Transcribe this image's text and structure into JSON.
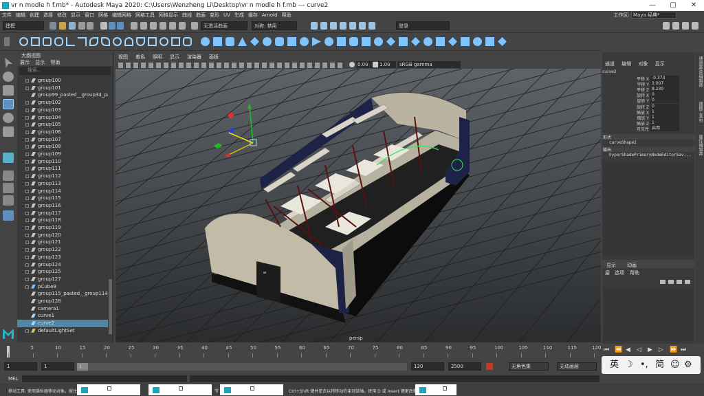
{
  "window": {
    "title": "vr n modle h f.mb* - Autodesk Maya 2020: C:\\Users\\Wenzheng Li\\Desktop\\vr n modle h f.mb   ---   curve2",
    "minimize": "—",
    "maximize": "▢",
    "close": "✕"
  },
  "menubar": {
    "items": [
      "文件",
      "编辑",
      "创建",
      "选择",
      "修改",
      "显示",
      "窗口",
      "网格",
      "编辑网格",
      "网格工具",
      "网格显示",
      "曲线",
      "曲面",
      "变形",
      "UV",
      "生成",
      "缓存",
      "Arnold",
      "帮助"
    ],
    "workspace_label": "工作区:",
    "workspace_value": "Maya 经典*"
  },
  "statusline": {
    "mode": "建模",
    "live_surface": "无激活曲面",
    "symmetry": "对称: 禁用",
    "login": "登录"
  },
  "outliner": {
    "title": "大纲视图",
    "menu": [
      "展示",
      "显示",
      "帮助"
    ],
    "search_placeholder": "搜索...",
    "items": [
      {
        "label": "group100",
        "type": "group",
        "expand": true
      },
      {
        "label": "group101",
        "type": "group",
        "expand": true
      },
      {
        "label": "group99_pasted__group34_pasts",
        "type": "group",
        "expand": false
      },
      {
        "label": "group102",
        "type": "group",
        "expand": true
      },
      {
        "label": "group103",
        "type": "group",
        "expand": true
      },
      {
        "label": "group104",
        "type": "group",
        "expand": true
      },
      {
        "label": "group105",
        "type": "group",
        "expand": true
      },
      {
        "label": "group106",
        "type": "group",
        "expand": true
      },
      {
        "label": "group107",
        "type": "group",
        "expand": true
      },
      {
        "label": "group108",
        "type": "group",
        "expand": true
      },
      {
        "label": "group109",
        "type": "group",
        "expand": true
      },
      {
        "label": "group110",
        "type": "group",
        "expand": true
      },
      {
        "label": "group111",
        "type": "group",
        "expand": true
      },
      {
        "label": "group112",
        "type": "group",
        "expand": true
      },
      {
        "label": "group113",
        "type": "group",
        "expand": true
      },
      {
        "label": "group114",
        "type": "group",
        "expand": true
      },
      {
        "label": "group115",
        "type": "group",
        "expand": true
      },
      {
        "label": "group116",
        "type": "group",
        "expand": true
      },
      {
        "label": "group117",
        "type": "group",
        "expand": true
      },
      {
        "label": "group118",
        "type": "group",
        "expand": true
      },
      {
        "label": "group119",
        "type": "group",
        "expand": true
      },
      {
        "label": "group120",
        "type": "group",
        "expand": true
      },
      {
        "label": "group121",
        "type": "group",
        "expand": true
      },
      {
        "label": "group122",
        "type": "group",
        "expand": true
      },
      {
        "label": "group123",
        "type": "group",
        "expand": true
      },
      {
        "label": "group124",
        "type": "group",
        "expand": true
      },
      {
        "label": "group125",
        "type": "group",
        "expand": true
      },
      {
        "label": "group127",
        "type": "group",
        "expand": true
      },
      {
        "label": "pCube9",
        "type": "mesh",
        "expand": true
      },
      {
        "label": "group115_pasted__group114_pa",
        "type": "group",
        "expand": false
      },
      {
        "label": "group128",
        "type": "group",
        "expand": false
      },
      {
        "label": "camera1",
        "type": "camera",
        "expand": false
      },
      {
        "label": "curve1",
        "type": "curve",
        "expand": false
      },
      {
        "label": "curve2",
        "type": "curve",
        "expand": false,
        "selected": true
      },
      {
        "label": "defaultLightSet",
        "type": "set",
        "expand": true
      }
    ]
  },
  "viewport": {
    "menu": [
      "视图",
      "着色",
      "照明",
      "显示",
      "渲染器",
      "面板"
    ],
    "exposure": "0.00",
    "gamma": "1.00",
    "color_space": "sRGB gamma",
    "camera_label": "persp"
  },
  "channelbox": {
    "menu": [
      "通道",
      "编辑",
      "对象",
      "显示"
    ],
    "object": "curve2",
    "attributes": [
      {
        "name": "平移 X",
        "value": "-0.373"
      },
      {
        "name": "平移 Y",
        "value": "3.007"
      },
      {
        "name": "平移 Z",
        "value": "8.239"
      },
      {
        "name": "旋转 X",
        "value": "0"
      },
      {
        "name": "旋转 Y",
        "value": "0"
      },
      {
        "name": "旋转 Z",
        "value": "0"
      },
      {
        "name": "缩放 X",
        "value": "1"
      },
      {
        "name": "缩放 Y",
        "value": "1"
      },
      {
        "name": "缩放 Z",
        "value": "1"
      },
      {
        "name": "可见性",
        "value": "启用"
      }
    ],
    "shapes_label": "形状",
    "shape_name": "curveShape2",
    "outputs_label": "输出",
    "output_name": "hyperShadePrimaryNodeEditorSav..."
  },
  "side_tabs": [
    "通道盒/层编辑器",
    "建模工具包",
    "属性编辑器"
  ],
  "layer_editor": {
    "tabs": [
      "显示",
      "动画"
    ],
    "menu": [
      "层",
      "选项",
      "帮助"
    ]
  },
  "timeline": {
    "ticks": [
      "1",
      "5",
      "10",
      "15",
      "20",
      "25",
      "30",
      "35",
      "40",
      "45",
      "50",
      "55",
      "60",
      "65",
      "70",
      "75",
      "80",
      "85",
      "90",
      "95",
      "100",
      "105",
      "110",
      "115",
      "120"
    ],
    "current": "1"
  },
  "range": {
    "start": "1",
    "start2": "1",
    "slider_label": "1",
    "end": "120",
    "end2": "2500",
    "char_set": "无角色集",
    "anim_layer": "无动画层"
  },
  "cmdline": {
    "label": "MEL"
  },
  "helpline": {
    "left": "移动工具: 使用操纵器移动对象。按住",
    "mid": "节",
    "right": "Ctrl+Shift 键并单击以将移动约束到该轴。使用 D 或 Insert 键更改枢轴位置和轴方向。"
  },
  "ime": {
    "lang": "英",
    "moon": "☽",
    "dot": "•,",
    "simp": "简",
    "face": "☺",
    "gear": "⚙"
  }
}
